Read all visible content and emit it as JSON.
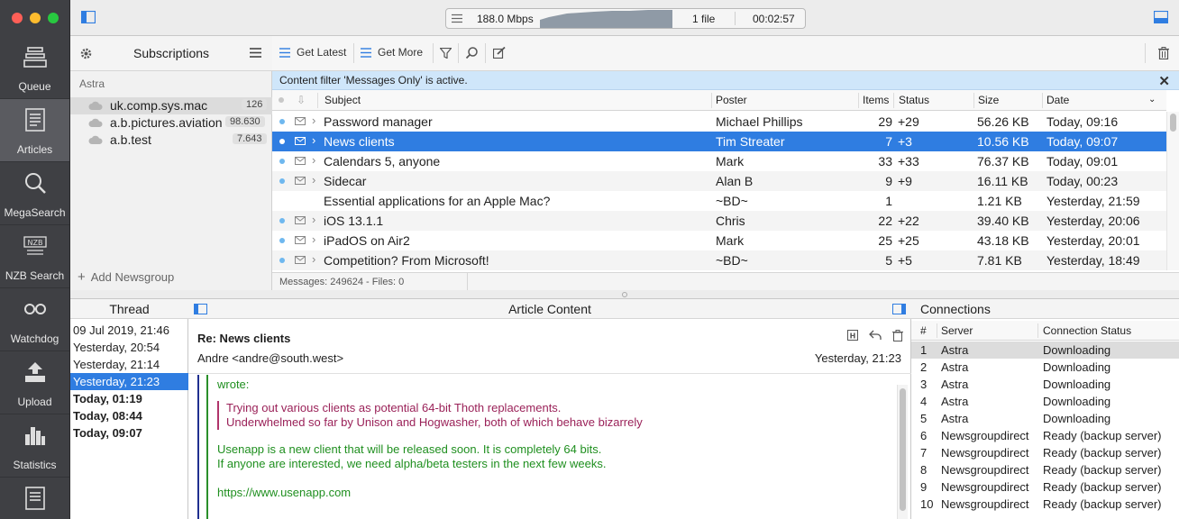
{
  "colors": {
    "selection": "#2f7de1",
    "rail": "#3f4044",
    "filter_bg": "#cfe6fa",
    "unread_dot": "#6fb8ef",
    "quote_green": "#1f8f1f",
    "quote_red": "#9a2158"
  },
  "status": {
    "speed": "188.0 Mbps",
    "files": "1 file",
    "time": "00:02:57"
  },
  "rail": [
    {
      "label": "Queue",
      "icon": "queue-icon"
    },
    {
      "label": "Articles",
      "icon": "articles-icon"
    },
    {
      "label": "MegaSearch",
      "icon": "search-icon"
    },
    {
      "label": "NZB Search",
      "icon": "nzb-icon"
    },
    {
      "label": "Watchdog",
      "icon": "watchdog-icon"
    },
    {
      "label": "Upload",
      "icon": "upload-icon"
    },
    {
      "label": "Statistics",
      "icon": "statistics-icon"
    }
  ],
  "subscriptions": {
    "title": "Subscriptions",
    "group": "Astra",
    "items": [
      {
        "name": "uk.comp.sys.mac",
        "count": "126"
      },
      {
        "name": "a.b.pictures.aviation",
        "count": "98.630"
      },
      {
        "name": "a.b.test",
        "count": "7.643"
      }
    ],
    "add_label": "Add Newsgroup"
  },
  "articles_toolbar": {
    "get_latest": "Get Latest",
    "get_more": "Get More"
  },
  "filter_notice": "Content filter 'Messages Only' is active.",
  "columns": {
    "subject": "Subject",
    "poster": "Poster",
    "items": "Items",
    "status": "Status",
    "size": "Size",
    "date": "Date"
  },
  "articles": [
    {
      "subject": "Password manager",
      "poster": "Michael Phillips",
      "items": "29",
      "status": "+29",
      "size": "56.26 KB",
      "date": "Today, 09:16"
    },
    {
      "subject": "News clients",
      "poster": "Tim Streater",
      "items": "7",
      "status": "+3",
      "size": "10.56 KB",
      "date": "Today, 09:07"
    },
    {
      "subject": "Calendars 5, anyone",
      "poster": "Mark",
      "items": "33",
      "status": "+33",
      "size": "76.37 KB",
      "date": "Today, 09:01"
    },
    {
      "subject": "Sidecar",
      "poster": "Alan B",
      "items": "9",
      "status": "+9",
      "size": "16.11 KB",
      "date": "Today, 00:23"
    },
    {
      "subject": "Essential applications for an Apple Mac?",
      "poster": "~BD~",
      "items": "1",
      "status": "",
      "size": "1.21 KB",
      "date": "Yesterday, 21:59"
    },
    {
      "subject": "iOS 13.1.1",
      "poster": "Chris",
      "items": "22",
      "status": "+22",
      "size": "39.40 KB",
      "date": "Yesterday, 20:06"
    },
    {
      "subject": "iPadOS on Air2",
      "poster": "Mark",
      "items": "25",
      "status": "+25",
      "size": "43.18 KB",
      "date": "Yesterday, 20:01"
    },
    {
      "subject": "Competition? From Microsoft!",
      "poster": "~BD~",
      "items": "5",
      "status": "+5",
      "size": "7.81 KB",
      "date": "Yesterday, 18:49"
    }
  ],
  "messages_status": "Messages: 249624 - Files: 0",
  "thread": {
    "title": "Thread",
    "items": [
      "09 Jul 2019, 21:46",
      "Yesterday, 20:54",
      "Yesterday, 21:14",
      "Yesterday, 21:23",
      "Today, 01:19",
      "Today, 08:44",
      "Today, 09:07"
    ]
  },
  "article": {
    "pane_title": "Article Content",
    "subject": "Re: News clients",
    "from": "Andre <andre@south.west>",
    "date": "Yesterday, 21:23",
    "wrote": "wrote:",
    "quote1": "Trying out various clients as potential 64-bit Thoth replacements.",
    "quote2": "Underwhelmed so far by Unison and Hogwasher, both of which behave bizarrely",
    "line1": "Usenapp is a new client that will be released soon. It is completely 64 bits.",
    "line2": "If anyone are interested, we need alpha/beta testers in the next few weeks.",
    "link": "https://www.usenapp.com"
  },
  "connections": {
    "title": "Connections",
    "col_num": "#",
    "col_server": "Server",
    "col_status": "Connection Status",
    "rows": [
      {
        "n": "1",
        "server": "Astra",
        "status": "Downloading"
      },
      {
        "n": "2",
        "server": "Astra",
        "status": "Downloading"
      },
      {
        "n": "3",
        "server": "Astra",
        "status": "Downloading"
      },
      {
        "n": "4",
        "server": "Astra",
        "status": "Downloading"
      },
      {
        "n": "5",
        "server": "Astra",
        "status": "Downloading"
      },
      {
        "n": "6",
        "server": "Newsgroupdirect",
        "status": "Ready (backup server)"
      },
      {
        "n": "7",
        "server": "Newsgroupdirect",
        "status": "Ready (backup server)"
      },
      {
        "n": "8",
        "server": "Newsgroupdirect",
        "status": "Ready (backup server)"
      },
      {
        "n": "9",
        "server": "Newsgroupdirect",
        "status": "Ready (backup server)"
      },
      {
        "n": "10",
        "server": "Newsgroupdirect",
        "status": "Ready (backup server)"
      }
    ]
  }
}
